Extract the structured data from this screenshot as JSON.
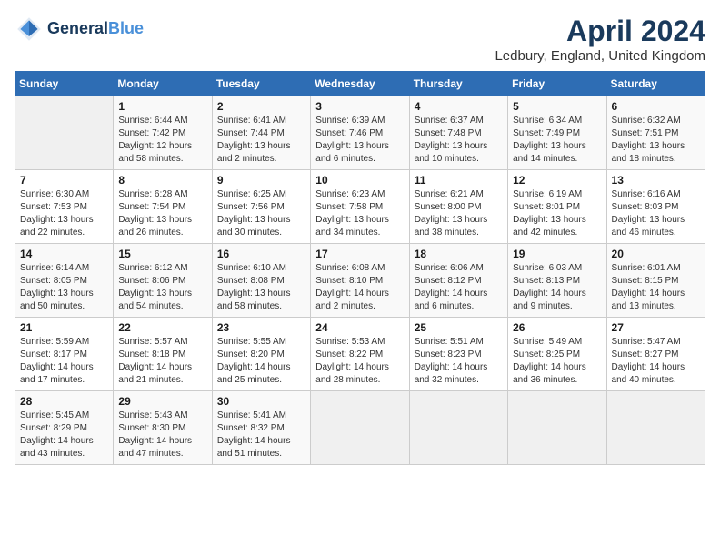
{
  "header": {
    "logo_line1": "General",
    "logo_line2": "Blue",
    "month": "April 2024",
    "location": "Ledbury, England, United Kingdom"
  },
  "weekdays": [
    "Sunday",
    "Monday",
    "Tuesday",
    "Wednesday",
    "Thursday",
    "Friday",
    "Saturday"
  ],
  "weeks": [
    [
      {
        "day": "",
        "info": ""
      },
      {
        "day": "1",
        "info": "Sunrise: 6:44 AM\nSunset: 7:42 PM\nDaylight: 12 hours\nand 58 minutes."
      },
      {
        "day": "2",
        "info": "Sunrise: 6:41 AM\nSunset: 7:44 PM\nDaylight: 13 hours\nand 2 minutes."
      },
      {
        "day": "3",
        "info": "Sunrise: 6:39 AM\nSunset: 7:46 PM\nDaylight: 13 hours\nand 6 minutes."
      },
      {
        "day": "4",
        "info": "Sunrise: 6:37 AM\nSunset: 7:48 PM\nDaylight: 13 hours\nand 10 minutes."
      },
      {
        "day": "5",
        "info": "Sunrise: 6:34 AM\nSunset: 7:49 PM\nDaylight: 13 hours\nand 14 minutes."
      },
      {
        "day": "6",
        "info": "Sunrise: 6:32 AM\nSunset: 7:51 PM\nDaylight: 13 hours\nand 18 minutes."
      }
    ],
    [
      {
        "day": "7",
        "info": "Sunrise: 6:30 AM\nSunset: 7:53 PM\nDaylight: 13 hours\nand 22 minutes."
      },
      {
        "day": "8",
        "info": "Sunrise: 6:28 AM\nSunset: 7:54 PM\nDaylight: 13 hours\nand 26 minutes."
      },
      {
        "day": "9",
        "info": "Sunrise: 6:25 AM\nSunset: 7:56 PM\nDaylight: 13 hours\nand 30 minutes."
      },
      {
        "day": "10",
        "info": "Sunrise: 6:23 AM\nSunset: 7:58 PM\nDaylight: 13 hours\nand 34 minutes."
      },
      {
        "day": "11",
        "info": "Sunrise: 6:21 AM\nSunset: 8:00 PM\nDaylight: 13 hours\nand 38 minutes."
      },
      {
        "day": "12",
        "info": "Sunrise: 6:19 AM\nSunset: 8:01 PM\nDaylight: 13 hours\nand 42 minutes."
      },
      {
        "day": "13",
        "info": "Sunrise: 6:16 AM\nSunset: 8:03 PM\nDaylight: 13 hours\nand 46 minutes."
      }
    ],
    [
      {
        "day": "14",
        "info": "Sunrise: 6:14 AM\nSunset: 8:05 PM\nDaylight: 13 hours\nand 50 minutes."
      },
      {
        "day": "15",
        "info": "Sunrise: 6:12 AM\nSunset: 8:06 PM\nDaylight: 13 hours\nand 54 minutes."
      },
      {
        "day": "16",
        "info": "Sunrise: 6:10 AM\nSunset: 8:08 PM\nDaylight: 13 hours\nand 58 minutes."
      },
      {
        "day": "17",
        "info": "Sunrise: 6:08 AM\nSunset: 8:10 PM\nDaylight: 14 hours\nand 2 minutes."
      },
      {
        "day": "18",
        "info": "Sunrise: 6:06 AM\nSunset: 8:12 PM\nDaylight: 14 hours\nand 6 minutes."
      },
      {
        "day": "19",
        "info": "Sunrise: 6:03 AM\nSunset: 8:13 PM\nDaylight: 14 hours\nand 9 minutes."
      },
      {
        "day": "20",
        "info": "Sunrise: 6:01 AM\nSunset: 8:15 PM\nDaylight: 14 hours\nand 13 minutes."
      }
    ],
    [
      {
        "day": "21",
        "info": "Sunrise: 5:59 AM\nSunset: 8:17 PM\nDaylight: 14 hours\nand 17 minutes."
      },
      {
        "day": "22",
        "info": "Sunrise: 5:57 AM\nSunset: 8:18 PM\nDaylight: 14 hours\nand 21 minutes."
      },
      {
        "day": "23",
        "info": "Sunrise: 5:55 AM\nSunset: 8:20 PM\nDaylight: 14 hours\nand 25 minutes."
      },
      {
        "day": "24",
        "info": "Sunrise: 5:53 AM\nSunset: 8:22 PM\nDaylight: 14 hours\nand 28 minutes."
      },
      {
        "day": "25",
        "info": "Sunrise: 5:51 AM\nSunset: 8:23 PM\nDaylight: 14 hours\nand 32 minutes."
      },
      {
        "day": "26",
        "info": "Sunrise: 5:49 AM\nSunset: 8:25 PM\nDaylight: 14 hours\nand 36 minutes."
      },
      {
        "day": "27",
        "info": "Sunrise: 5:47 AM\nSunset: 8:27 PM\nDaylight: 14 hours\nand 40 minutes."
      }
    ],
    [
      {
        "day": "28",
        "info": "Sunrise: 5:45 AM\nSunset: 8:29 PM\nDaylight: 14 hours\nand 43 minutes."
      },
      {
        "day": "29",
        "info": "Sunrise: 5:43 AM\nSunset: 8:30 PM\nDaylight: 14 hours\nand 47 minutes."
      },
      {
        "day": "30",
        "info": "Sunrise: 5:41 AM\nSunset: 8:32 PM\nDaylight: 14 hours\nand 51 minutes."
      },
      {
        "day": "",
        "info": ""
      },
      {
        "day": "",
        "info": ""
      },
      {
        "day": "",
        "info": ""
      },
      {
        "day": "",
        "info": ""
      }
    ]
  ]
}
